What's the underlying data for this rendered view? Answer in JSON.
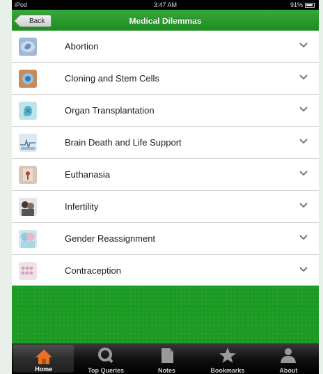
{
  "status": {
    "carrier": "iPod",
    "time": "3:47 AM",
    "battery": "91%"
  },
  "nav": {
    "back_label": "Back",
    "title": "Medical Dilemmas"
  },
  "items": [
    {
      "label": "Abortion",
      "icon": "fetus-icon"
    },
    {
      "label": "Cloning and Stem Cells",
      "icon": "cell-icon"
    },
    {
      "label": "Organ Transplantation",
      "icon": "organ-icon"
    },
    {
      "label": "Brain Death and Life Support",
      "icon": "life-support-icon"
    },
    {
      "label": "Euthanasia",
      "icon": "euthanasia-icon"
    },
    {
      "label": "Infertility",
      "icon": "couple-icon"
    },
    {
      "label": "Gender Reassignment",
      "icon": "gender-icon"
    },
    {
      "label": "Contraception",
      "icon": "pills-icon"
    }
  ],
  "tabs": [
    {
      "label": "Home",
      "icon": "home-icon",
      "active": true
    },
    {
      "label": "Top Queries",
      "icon": "search-q-icon",
      "active": false
    },
    {
      "label": "Notes",
      "icon": "notes-icon",
      "active": false
    },
    {
      "label": "Bookmarks",
      "icon": "star-icon",
      "active": false
    },
    {
      "label": "About",
      "icon": "person-icon",
      "active": false
    }
  ],
  "colors": {
    "accent": "#1b8a1f",
    "tab_active": "#e8722a"
  }
}
